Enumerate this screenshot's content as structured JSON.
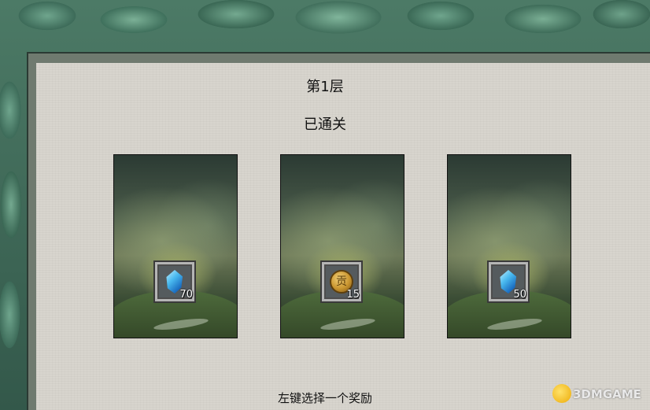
{
  "header": {
    "floor_title": "第1层",
    "status_title": "已通关"
  },
  "cards": [
    {
      "reward": {
        "icon": "crystal-icon",
        "count": "70"
      }
    },
    {
      "reward": {
        "icon": "coin-icon",
        "coin_glyph": "贡",
        "count": "15"
      }
    },
    {
      "reward": {
        "icon": "crystal-icon",
        "count": "50"
      }
    }
  ],
  "instruction": "左键选择一个奖励",
  "watermark": {
    "text": "3DMGAME"
  }
}
